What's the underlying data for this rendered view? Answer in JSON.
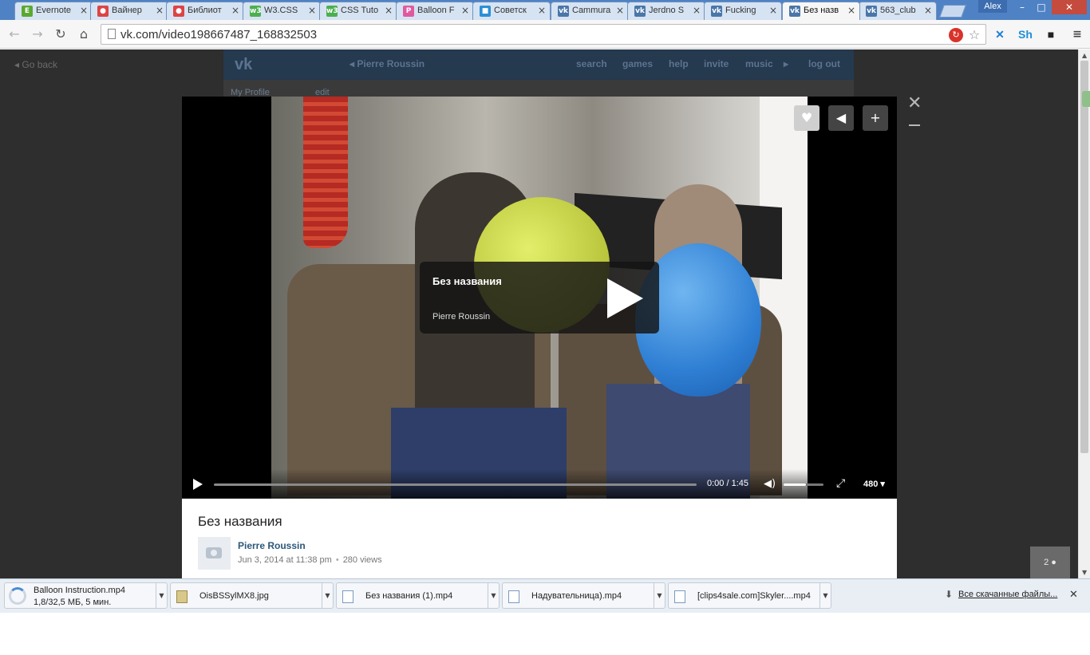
{
  "browser": {
    "tabs": [
      {
        "label": "Evernote",
        "favicon": "evernote-icon",
        "color": "#5aa832",
        "glyph": "E"
      },
      {
        "label": "Вайнер",
        "favicon": "colorful-icon",
        "color": "#d44",
        "glyph": "●"
      },
      {
        "label": "Библиот",
        "favicon": "colorful-icon",
        "color": "#d44",
        "glyph": "●"
      },
      {
        "label": "W3.CSS",
        "favicon": "w3-icon",
        "color": "#4caf50",
        "glyph": "w3"
      },
      {
        "label": "CSS Tuto",
        "favicon": "w3-icon",
        "color": "#4caf50",
        "glyph": "w3"
      },
      {
        "label": "Balloon F",
        "favicon": "p-icon",
        "color": "#e05aa0",
        "glyph": "P"
      },
      {
        "label": "Советск",
        "favicon": "cube-icon",
        "color": "#2b8fd6",
        "glyph": "■"
      },
      {
        "label": "Cammura",
        "favicon": "vk-icon",
        "color": "#4a76a8",
        "glyph": "vk"
      },
      {
        "label": "Jerdno S",
        "favicon": "vk-icon",
        "color": "#4a76a8",
        "glyph": "vk"
      },
      {
        "label": "Fucking",
        "favicon": "vk-icon",
        "color": "#4a76a8",
        "glyph": "vk"
      },
      {
        "label": "Без назв",
        "favicon": "vk-icon",
        "color": "#4a76a8",
        "glyph": "vk",
        "active": true
      },
      {
        "label": "563_club",
        "favicon": "vk-icon",
        "color": "#4a76a8",
        "glyph": "vk"
      }
    ],
    "user": "Alex",
    "url": "vk.com/video198667487_168832503"
  },
  "page": {
    "go_back": "Go back",
    "vk_user": "Pierre Roussin",
    "nav": [
      "search",
      "games",
      "help",
      "invite",
      "music",
      "log out"
    ],
    "my_profile": "My Profile",
    "edit": "edit",
    "friends_count": "2"
  },
  "video": {
    "overlay_title": "Без названия",
    "overlay_author": "Pierre Roussin",
    "time": "0:00 / 1:45",
    "quality": "480",
    "progress_fraction": 0,
    "volume_fraction": 0.55,
    "title": "Без названия",
    "author": "Pierre Roussin",
    "date": "Jun 3, 2014 at 11:38 pm",
    "views": "280 views"
  },
  "downloads": {
    "items": [
      {
        "name": "Balloon Instruction.mp4",
        "status": "1,8/32,5 МБ, 5 мин.",
        "in_progress": true
      },
      {
        "name": "OisBSSylMX8.jpg",
        "type": "jpg"
      },
      {
        "name": "Без названия (1).mp4"
      },
      {
        "name": "Надувательница).mp4"
      },
      {
        "name": "[clips4sale.com]Skyler....mp4"
      }
    ],
    "show_all": "Все скачанные файлы..."
  }
}
